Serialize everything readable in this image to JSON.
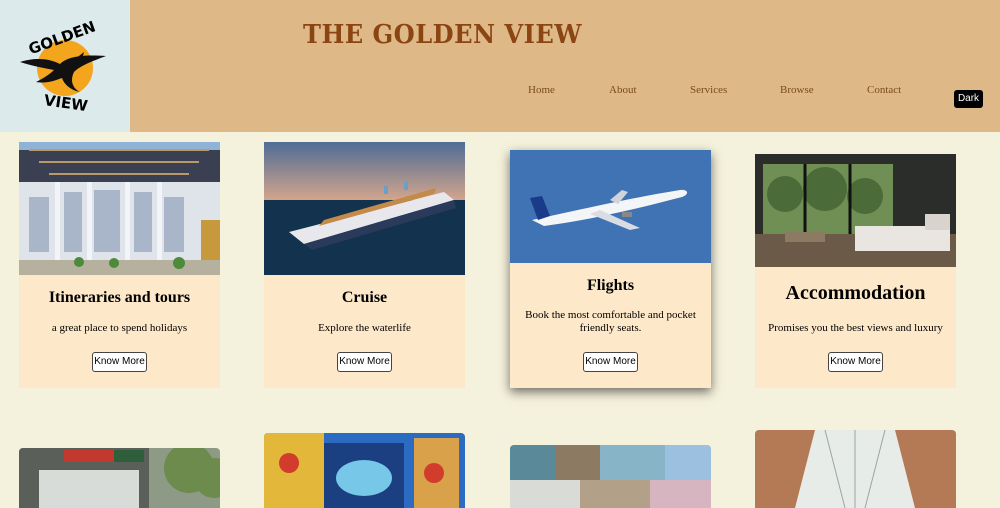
{
  "header": {
    "title": "THE GOLDEN VIEW",
    "logo_text_top": "GOLDEN",
    "logo_text_bottom": "VIEW",
    "nav": [
      "Home",
      "About",
      "Services",
      "Browse",
      "Contact"
    ],
    "dark_toggle": "Dark"
  },
  "cards": [
    {
      "title": "Itineraries and tours",
      "description": "a great place to spend holidays",
      "button": "Know More"
    },
    {
      "title": "Cruise",
      "description": "Explore the waterlife",
      "button": "Know More"
    },
    {
      "title": "Flights",
      "description": "Book the most comfortable and pocket friendly seats.",
      "button": "Know More"
    },
    {
      "title": "Accommodation",
      "description": "Promises you the best views and luxury",
      "button": "Know More"
    }
  ],
  "colors": {
    "page_bg": "#f4f1dc",
    "header_bg": "#deb887",
    "title_color": "#8b4513",
    "card_bg": "#fde8c9"
  }
}
